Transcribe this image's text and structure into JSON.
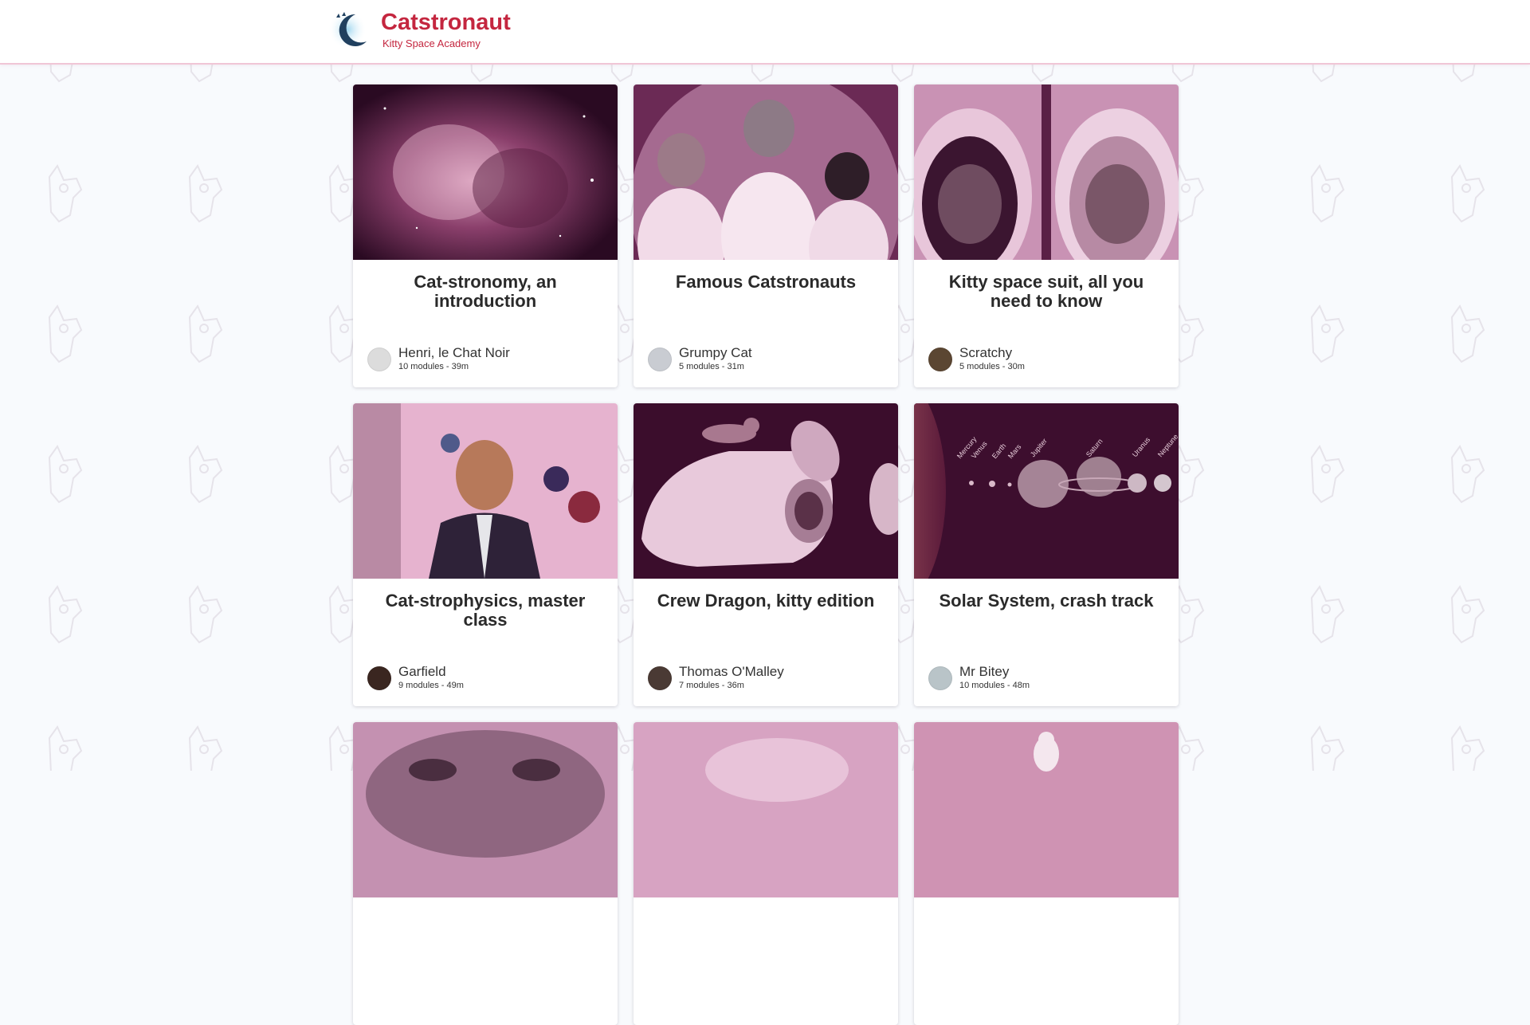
{
  "brand": {
    "title": "Catstronaut",
    "subtitle": "Kitty Space Academy",
    "accent": "#c4263f",
    "logo_icon": "moon-cat-icon"
  },
  "tracks": [
    {
      "title": "Cat-stronomy, an introduction",
      "author": "Henri, le Chat Noir",
      "meta": "10 modules - 39m",
      "image": "nebula-cat",
      "avatar_color": "#dcdcdc"
    },
    {
      "title": "Famous Catstronauts",
      "author": "Grumpy Cat",
      "meta": "5 modules - 31m",
      "image": "astronaut-cats-moon",
      "avatar_color": "#c9ccd2"
    },
    {
      "title": "Kitty space suit, all you need to know",
      "author": "Scratchy",
      "meta": "5 modules - 30m",
      "image": "helmet-cats",
      "avatar_color": "#5b4632"
    },
    {
      "title": "Cat-strophysics, master class",
      "author": "Garfield",
      "meta": "9 modules - 49m",
      "image": "suit-cat-planets",
      "avatar_color": "#3a2620"
    },
    {
      "title": "Crew Dragon, kitty edition",
      "author": "Thomas O'Malley",
      "meta": "7 modules - 36m",
      "image": "capsule-cat",
      "avatar_color": "#4a3a34"
    },
    {
      "title": "Solar System, crash track",
      "author": "Mr Bitey",
      "meta": "10 modules - 48m",
      "image": "cat-planets-row",
      "avatar_color": "#b9c4c8"
    },
    {
      "title": "",
      "author": "",
      "meta": "",
      "image": "tabby-closeup",
      "avatar_color": "#ccc"
    },
    {
      "title": "",
      "author": "",
      "meta": "",
      "image": "pink-blur",
      "avatar_color": "#ccc"
    },
    {
      "title": "",
      "author": "",
      "meta": "",
      "image": "white-cat-pink",
      "avatar_color": "#ccc"
    }
  ],
  "planet_labels": [
    "Mercury",
    "Venus",
    "Earth",
    "Mars",
    "Jupiter",
    "Saturn",
    "Uranus",
    "Neptune"
  ],
  "colors": {
    "page_bg": "#f8fafd",
    "overlay_pink": "#c86496",
    "dark_plum": "#3a0a28"
  }
}
